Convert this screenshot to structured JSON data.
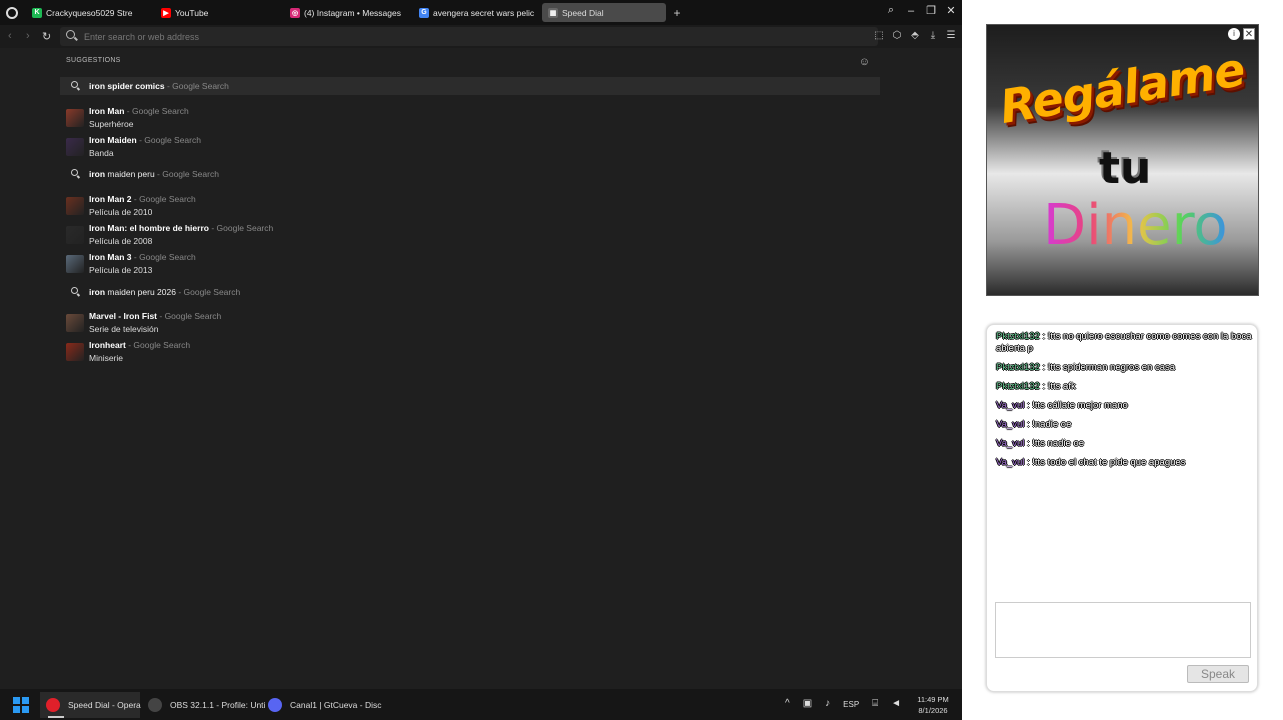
{
  "tabs": [
    {
      "label": "Crackyqueso5029 Stre",
      "color": "#1db954",
      "glyph": "K"
    },
    {
      "label": "YouTube",
      "color": "#ff0000",
      "glyph": "▶"
    },
    {
      "label": "(4) Instagram • Messages",
      "color": "#d62976",
      "glyph": "◎"
    },
    {
      "label": "avengera secret wars pelic",
      "color": "#4285f4",
      "glyph": "G"
    },
    {
      "label": "Speed Dial",
      "color": "#666666",
      "glyph": "▦",
      "active": true
    }
  ],
  "address": {
    "placeholder": "Enter search or web address",
    "value": ""
  },
  "suggestions": {
    "header": "SUGGESTIONS",
    "items": [
      {
        "kind": "search",
        "bold": "iron spider comics",
        "suffix": " - Google Search",
        "sub": "",
        "highlight": true
      },
      {
        "kind": "thumb",
        "bold": "Iron Man",
        "suffix": " - Google Search",
        "sub": "Superhéroe",
        "color": "#8a3a2a"
      },
      {
        "kind": "thumb",
        "bold": "Iron Maiden",
        "suffix": " - Google Search",
        "sub": "Banda",
        "color": "#3a2a4a"
      },
      {
        "kind": "search",
        "bold": "iron",
        "rest": " maiden peru",
        "suffix": " - Google Search",
        "sub": ""
      },
      {
        "kind": "thumb",
        "bold": "Iron Man 2",
        "suffix": " - Google Search",
        "sub": "Película de 2010",
        "color": "#6a3020"
      },
      {
        "kind": "thumb",
        "bold": "Iron Man: el hombre de hierro",
        "suffix": " - Google Search",
        "sub": "Película de 2008",
        "color": "#2a2a2a"
      },
      {
        "kind": "thumb",
        "bold": "Iron Man 3",
        "suffix": " - Google Search",
        "sub": "Película de 2013",
        "color": "#5a6a7a"
      },
      {
        "kind": "search",
        "bold": "iron",
        "rest": " maiden peru 2026",
        "suffix": " - Google Search",
        "sub": ""
      },
      {
        "kind": "thumb",
        "bold": "Marvel - Iron Fist",
        "suffix": " - Google Search",
        "sub": "Serie de televisión",
        "color": "#6a4a3a"
      },
      {
        "kind": "thumb",
        "bold": "Ironheart",
        "suffix": " - Google Search",
        "sub": "Miniserie",
        "color": "#8a2a1a"
      }
    ]
  },
  "ad": {
    "line1": "Regálame",
    "line2": "tu",
    "line3": "Dinero"
  },
  "chat": {
    "messages": [
      {
        "user": "Pktztxl132",
        "text": " : !tts no quiero escuchar como comes con la boca abierta p",
        "color": "#5fbf8a"
      },
      {
        "user": "Pktztxl132",
        "text": " : !tts spiderman negros en casa",
        "color": "#5fbf8a"
      },
      {
        "user": "Pktztxl132",
        "text": " : !tts afk",
        "color": "#5fbf8a"
      },
      {
        "user": "Va_vul",
        "text": " : !tts cállate mejor mano",
        "color": "#a070d0"
      },
      {
        "user": "Va_vul",
        "text": " : !nadie oe",
        "color": "#a070d0"
      },
      {
        "user": "Va_vul",
        "text": " : !tts nadie oe",
        "color": "#a070d0"
      },
      {
        "user": "Va_vul",
        "text": " : !tts todo el chat te pide que apagues",
        "color": "#a070d0"
      }
    ],
    "speak_label": "Speak"
  },
  "taskbar": {
    "apps": [
      {
        "label": "Speed Dial - Opera",
        "color": "#e0202a",
        "active": true
      },
      {
        "label": "OBS 32.1.1 - Profile: Unti",
        "color": "#444444"
      },
      {
        "label": "Canal1 | GtCueva - Disc",
        "color": "#5865f2"
      }
    ],
    "lang": "ESP",
    "time": "11:49 PM",
    "date": "8/1/2026"
  }
}
